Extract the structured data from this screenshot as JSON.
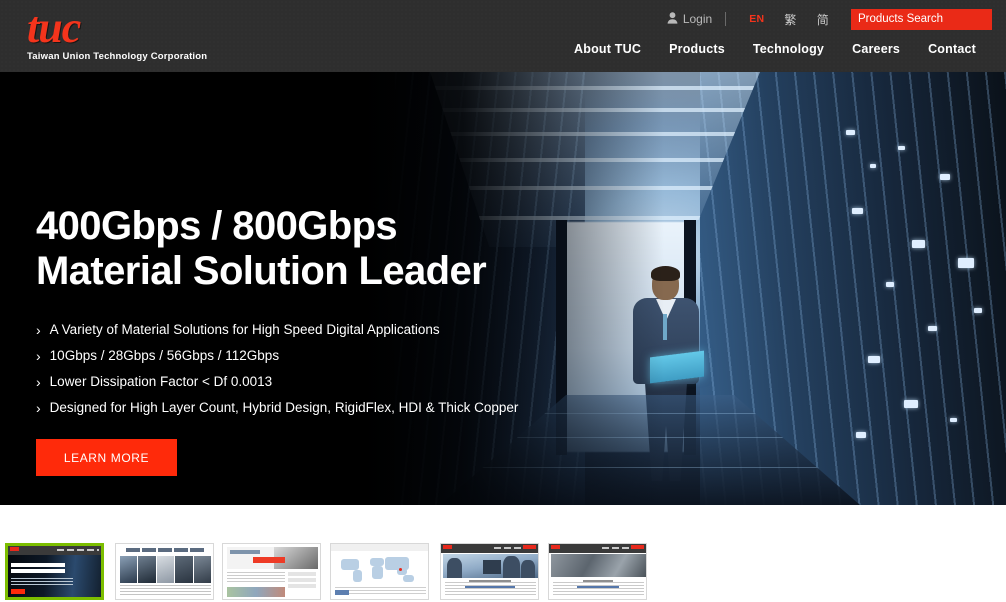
{
  "header": {
    "logo": {
      "wordmark": "tuc",
      "subtitle": "Taiwan Union Technology Corporation"
    },
    "utility": {
      "login_label": "Login",
      "login_icon": "person-icon",
      "languages": [
        {
          "label": "EN",
          "active": true
        },
        {
          "label": "繁",
          "active": false
        },
        {
          "label": "简",
          "active": false
        }
      ],
      "search": {
        "placeholder": "Products Search",
        "value": "",
        "icon": "search-icon",
        "background": "#ea2a17"
      }
    },
    "nav": [
      {
        "label": "About TUC"
      },
      {
        "label": "Products"
      },
      {
        "label": "Technology"
      },
      {
        "label": "Careers"
      },
      {
        "label": "Contact"
      }
    ],
    "background": "#2e2e2e"
  },
  "hero": {
    "title_line1": "400Gbps / 800Gbps",
    "title_line2": "Material Solution Leader",
    "bullet_marker": "›",
    "bullets": [
      "A Variety of Material Solutions for High Speed Digital Applications",
      "10Gbps / 28Gbps / 56Gbps / 112Gbps",
      "Lower Dissipation Factor < Df 0.0013",
      "Designed for High Layer Count, Hybrid Design, RigidFlex, HDI & Thick Copper"
    ],
    "cta_label": "LEARN MORE",
    "cta_color": "#ff2a0a",
    "image_description": "data-center server room aisle with man holding laptop"
  },
  "thumbnails": {
    "active_border_color": "#7cbe00",
    "active_index": 0,
    "items": [
      {
        "name": "slide-hero-400-800gbps",
        "active": true
      },
      {
        "name": "slide-products-grid",
        "active": false
      },
      {
        "name": "slide-technology",
        "active": false
      },
      {
        "name": "slide-global-map",
        "active": false
      },
      {
        "name": "slide-careers",
        "active": false
      },
      {
        "name": "slide-contact",
        "active": false
      }
    ]
  }
}
